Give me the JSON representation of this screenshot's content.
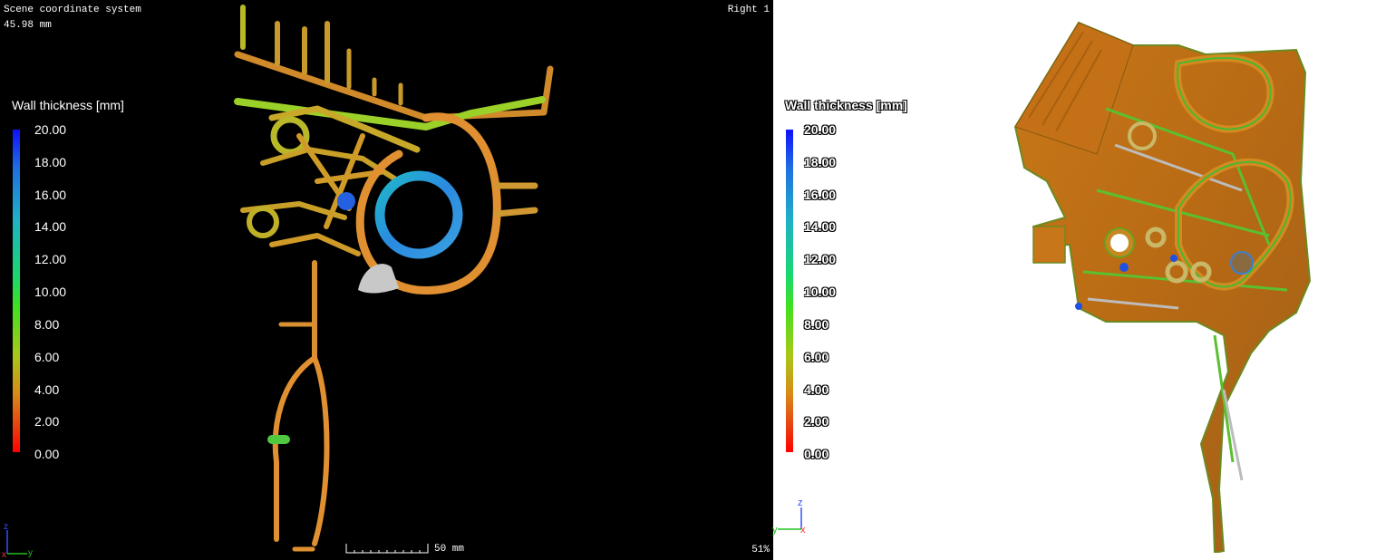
{
  "left_view": {
    "coordinate_system": "Scene coordinate system",
    "value": "45.98 mm",
    "view_name": "Right 1",
    "zoom": "51%",
    "scale_bar_label": "50 mm",
    "axes": {
      "z": "z",
      "x": "x",
      "y": "y"
    }
  },
  "legend": {
    "title": "Wall thickness [mm]",
    "ticks": [
      "20.00",
      "18.00",
      "16.00",
      "14.00",
      "12.00",
      "10.00",
      "8.00",
      "6.00",
      "4.00",
      "2.00",
      "0.00"
    ],
    "colors": {
      "max": "#1010ff",
      "mid": "#18d870",
      "low": "#d88a18",
      "min": "#ff0000"
    }
  },
  "right_view": {
    "legend_title": "Wall thickness [mm]",
    "axes": {
      "z": "z",
      "x": "x",
      "y": "y"
    }
  }
}
